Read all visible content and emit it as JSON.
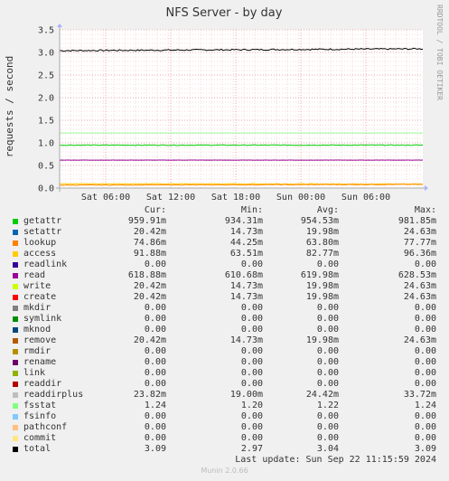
{
  "colors": {
    "background": "#f0f0f0",
    "plot_bg": "#ffffff",
    "grid_minor": "#f0b0b0",
    "grid_major": "#e07070"
  },
  "chart_data": {
    "type": "line",
    "title": "NFS Server - by day",
    "ylabel": "requests / second",
    "side_label": "RRDTOOL / TOBI OETIKER",
    "ylim": [
      0,
      3.5
    ],
    "yticks": [
      "0.0",
      "0.5",
      "1.0",
      "1.5",
      "2.0",
      "2.5",
      "3.0",
      "3.5"
    ],
    "xticks": [
      "Sat 06:00",
      "Sat 12:00",
      "Sat 18:00",
      "Sun 00:00",
      "Sun 06:00"
    ],
    "grid": true,
    "series": [
      {
        "name": "total",
        "color": "#000000",
        "start": 3.04,
        "end": 3.08
      },
      {
        "name": "access",
        "color": "#ffcc00",
        "start": 0.095,
        "end": 0.09
      },
      {
        "name": "getattr",
        "color": "#00cc00",
        "start": 0.95,
        "end": 0.95
      },
      {
        "name": "read",
        "color": "#990099",
        "start": 0.619,
        "end": 0.619
      },
      {
        "name": "lookup",
        "color": "#ff8800",
        "start": 0.064,
        "end": 0.08
      },
      {
        "name": "fsstat",
        "color": "#99ff99",
        "start": 1.22,
        "end": 1.22
      }
    ]
  },
  "legend": {
    "headers": [
      "Cur:",
      "Min:",
      "Avg:",
      "Max:"
    ],
    "rows": [
      {
        "name": "getattr",
        "color": "#00cc00",
        "cur": "959.91m",
        "min": "934.31m",
        "avg": "954.53m",
        "max": "981.85m"
      },
      {
        "name": "setattr",
        "color": "#0066b3",
        "cur": "20.42m",
        "min": "14.73m",
        "avg": "19.98m",
        "max": "24.63m"
      },
      {
        "name": "lookup",
        "color": "#ff8000",
        "cur": "74.86m",
        "min": "44.25m",
        "avg": "63.80m",
        "max": "77.77m"
      },
      {
        "name": "access",
        "color": "#ffcc00",
        "cur": "91.88m",
        "min": "63.51m",
        "avg": "82.77m",
        "max": "96.36m"
      },
      {
        "name": "readlink",
        "color": "#330099",
        "cur": "0.00",
        "min": "0.00",
        "avg": "0.00",
        "max": "0.00"
      },
      {
        "name": "read",
        "color": "#990099",
        "cur": "618.88m",
        "min": "610.68m",
        "avg": "619.98m",
        "max": "628.53m"
      },
      {
        "name": "write",
        "color": "#ccff00",
        "cur": "20.42m",
        "min": "14.73m",
        "avg": "19.98m",
        "max": "24.63m"
      },
      {
        "name": "create",
        "color": "#ff0000",
        "cur": "20.42m",
        "min": "14.73m",
        "avg": "19.98m",
        "max": "24.63m"
      },
      {
        "name": "mkdir",
        "color": "#808080",
        "cur": "0.00",
        "min": "0.00",
        "avg": "0.00",
        "max": "0.00"
      },
      {
        "name": "symlink",
        "color": "#008f00",
        "cur": "0.00",
        "min": "0.00",
        "avg": "0.00",
        "max": "0.00"
      },
      {
        "name": "mknod",
        "color": "#00487d",
        "cur": "0.00",
        "min": "0.00",
        "avg": "0.00",
        "max": "0.00"
      },
      {
        "name": "remove",
        "color": "#b35a00",
        "cur": "20.42m",
        "min": "14.73m",
        "avg": "19.98m",
        "max": "24.63m"
      },
      {
        "name": "rmdir",
        "color": "#b38f00",
        "cur": "0.00",
        "min": "0.00",
        "avg": "0.00",
        "max": "0.00"
      },
      {
        "name": "rename",
        "color": "#6b006b",
        "cur": "0.00",
        "min": "0.00",
        "avg": "0.00",
        "max": "0.00"
      },
      {
        "name": "link",
        "color": "#8fb300",
        "cur": "0.00",
        "min": "0.00",
        "avg": "0.00",
        "max": "0.00"
      },
      {
        "name": "readdir",
        "color": "#b30000",
        "cur": "0.00",
        "min": "0.00",
        "avg": "0.00",
        "max": "0.00"
      },
      {
        "name": "readdirplus",
        "color": "#bebebe",
        "cur": "23.82m",
        "min": "19.00m",
        "avg": "24.42m",
        "max": "33.72m"
      },
      {
        "name": "fsstat",
        "color": "#80ff80",
        "cur": "1.24",
        "min": "1.20",
        "avg": "1.22",
        "max": "1.24"
      },
      {
        "name": "fsinfo",
        "color": "#80c9ff",
        "cur": "0.00",
        "min": "0.00",
        "avg": "0.00",
        "max": "0.00"
      },
      {
        "name": "pathconf",
        "color": "#ffc080",
        "cur": "0.00",
        "min": "0.00",
        "avg": "0.00",
        "max": "0.00"
      },
      {
        "name": "commit",
        "color": "#ffe680",
        "cur": "0.00",
        "min": "0.00",
        "avg": "0.00",
        "max": "0.00"
      },
      {
        "name": "total",
        "color": "#000000",
        "cur": "3.09",
        "min": "2.97",
        "avg": "3.04",
        "max": "3.09"
      }
    ]
  },
  "last_update": "Last update: Sun Sep 22 11:15:59 2024",
  "footer": "Munin 2.0.66"
}
